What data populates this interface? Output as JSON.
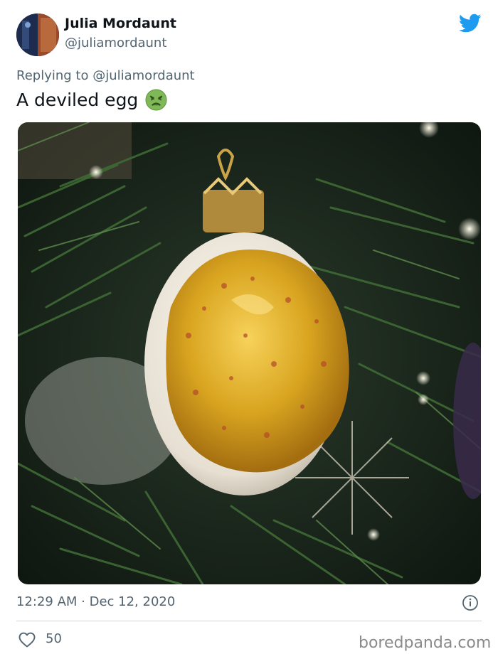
{
  "user": {
    "name": "Julia Mordaunt",
    "handle": "@juliamordaunt"
  },
  "reply": {
    "prefix": "Replying to ",
    "mention": "@juliamordaunt"
  },
  "tweet": {
    "text": "A deviled egg",
    "emoji_icon": "nauseated-face-emoji"
  },
  "meta": {
    "timestamp": "12:29 AM · Dec 12, 2020",
    "likes": "50"
  },
  "watermark": "boredpanda.com",
  "colors": {
    "twitter_blue": "#1d9bf0",
    "secondary_text": "#536471",
    "egg_yolk": "#d9a520"
  }
}
